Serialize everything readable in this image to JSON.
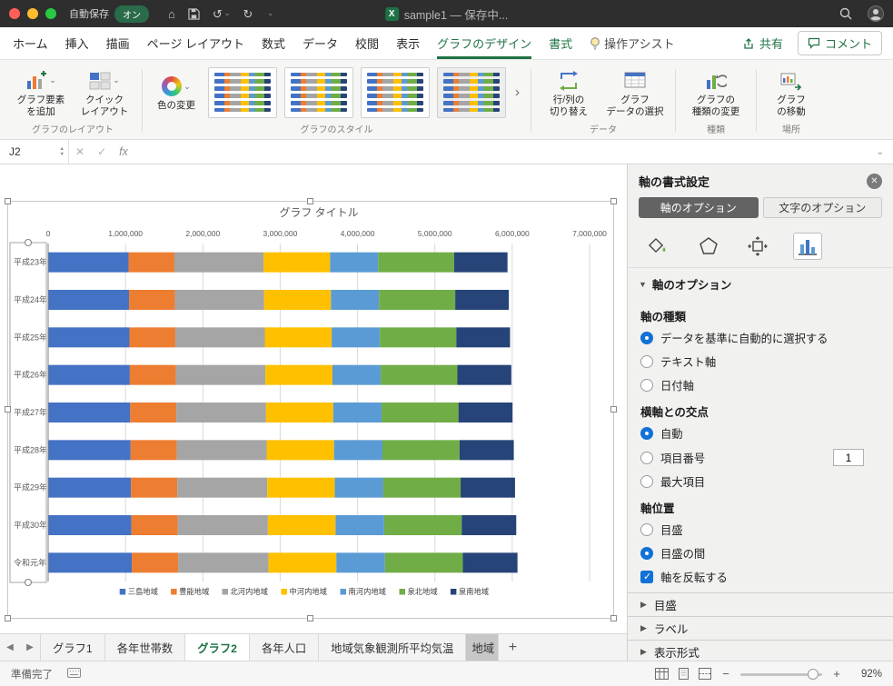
{
  "accent_color": "#217346",
  "titlebar": {
    "autosave_label": "自動保存",
    "autosave_state": "オン",
    "doc_title": "sample1 — 保存中..."
  },
  "ribbon_tabs": {
    "items": [
      {
        "label": "ホーム"
      },
      {
        "label": "挿入"
      },
      {
        "label": "描画"
      },
      {
        "label": "ページ レイアウト"
      },
      {
        "label": "数式"
      },
      {
        "label": "データ"
      },
      {
        "label": "校閲"
      },
      {
        "label": "表示"
      },
      {
        "label": "グラフのデザイン",
        "active": true
      },
      {
        "label": "書式",
        "contextual": true
      }
    ],
    "assist_label": "操作アシスト",
    "share_label": "共有",
    "comment_label": "コメント"
  },
  "ribbon": {
    "add_element_label": "グラフ要素\nを追加",
    "quick_layout_label": "クイック\nレイアウト",
    "change_colors_label": "色の変更",
    "switch_rowcol_label": "行/列の\n切り替え",
    "select_data_label": "グラフ\nデータの選択",
    "change_type_label": "グラフの\n種類の変更",
    "move_chart_label": "グラフ\nの移動",
    "group_labels": {
      "layout": "グラフのレイアウト",
      "styles": "グラフのスタイル",
      "data": "データ",
      "type": "種類",
      "location": "場所"
    }
  },
  "formula_bar": {
    "cell_ref": "J2",
    "fx_label": "fx"
  },
  "chart_data": {
    "type": "bar",
    "stacked": true,
    "orientation": "horizontal",
    "title": "グラフ タイトル",
    "categories": [
      "平成23年",
      "平成24年",
      "平成25年",
      "平成26年",
      "平成27年",
      "平成28年",
      "平成29年",
      "平成30年",
      "令和元年"
    ],
    "series": [
      {
        "name": "三島地域",
        "color": "#4472C4",
        "values": [
          1040000,
          1046000,
          1051000,
          1056000,
          1061000,
          1066000,
          1071000,
          1076000,
          1081000
        ]
      },
      {
        "name": "豊能地域",
        "color": "#ED7D31",
        "values": [
          592000,
          593000,
          594000,
          595000,
          596000,
          597000,
          598000,
          599000,
          600000
        ]
      },
      {
        "name": "北河内地域",
        "color": "#A5A5A5",
        "values": [
          1152000,
          1154000,
          1156000,
          1158000,
          1160000,
          1162000,
          1164000,
          1166000,
          1168000
        ]
      },
      {
        "name": "中河内地域",
        "color": "#FFC000",
        "values": [
          861000,
          863000,
          865000,
          867000,
          869000,
          871000,
          873000,
          875000,
          877000
        ]
      },
      {
        "name": "南河内地域",
        "color": "#5B9BD5",
        "values": [
          621000,
          622000,
          623000,
          624000,
          625000,
          626000,
          627000,
          628000,
          629000
        ]
      },
      {
        "name": "泉北地域",
        "color": "#70AD47",
        "values": [
          982000,
          985000,
          988000,
          991000,
          994000,
          997000,
          1000000,
          1003000,
          1006000
        ]
      },
      {
        "name": "泉南地域",
        "color": "#264478",
        "values": [
          691000,
          693000,
          695000,
          697000,
          699000,
          701000,
          703000,
          705000,
          707000
        ]
      }
    ],
    "x_axis": {
      "min": 0,
      "max": 7000000,
      "tick_interval": 1000000,
      "tick_labels": [
        "0",
        "1,000,000",
        "2,000,000",
        "3,000,000",
        "4,000,000",
        "5,000,000",
        "6,000,000",
        "7,000,000"
      ],
      "position": "top"
    },
    "legend_position": "bottom",
    "gridlines": true,
    "category_axis_reversed": true
  },
  "task_pane": {
    "title": "軸の書式設定",
    "tabs": [
      {
        "label": "軸のオプション",
        "active": true
      },
      {
        "label": "文字のオプション",
        "active": false
      }
    ],
    "section_header": "軸のオプション",
    "axis_type": {
      "heading": "軸の種類",
      "options": [
        {
          "label": "データを基準に自動的に選択する",
          "selected": true
        },
        {
          "label": "テキスト軸",
          "selected": false
        },
        {
          "label": "日付軸",
          "selected": false
        }
      ]
    },
    "axis_cross": {
      "heading": "横軸との交点",
      "options": [
        {
          "label": "自動",
          "selected": true
        },
        {
          "label": "項目番号",
          "selected": false,
          "input_value": "1"
        },
        {
          "label": "最大項目",
          "selected": false
        }
      ]
    },
    "axis_position": {
      "heading": "軸位置",
      "options": [
        {
          "label": "目盛",
          "selected": false
        },
        {
          "label": "目盛の間",
          "selected": true
        }
      ],
      "checkbox": {
        "label": "軸を反転する",
        "checked": true
      }
    },
    "collapsed_sections": [
      {
        "label": "目盛"
      },
      {
        "label": "ラベル"
      },
      {
        "label": "表示形式"
      }
    ]
  },
  "sheet_tabs": {
    "tabs": [
      {
        "label": "グラフ1"
      },
      {
        "label": "各年世帯数"
      },
      {
        "label": "グラフ2",
        "active": true
      },
      {
        "label": "各年人口"
      },
      {
        "label": "地域気象観測所平均気温"
      },
      {
        "label": "地域",
        "truncated": true
      }
    ],
    "add_label": "+"
  },
  "status_bar": {
    "ready_label": "準備完了",
    "zoom_label": "92%"
  }
}
